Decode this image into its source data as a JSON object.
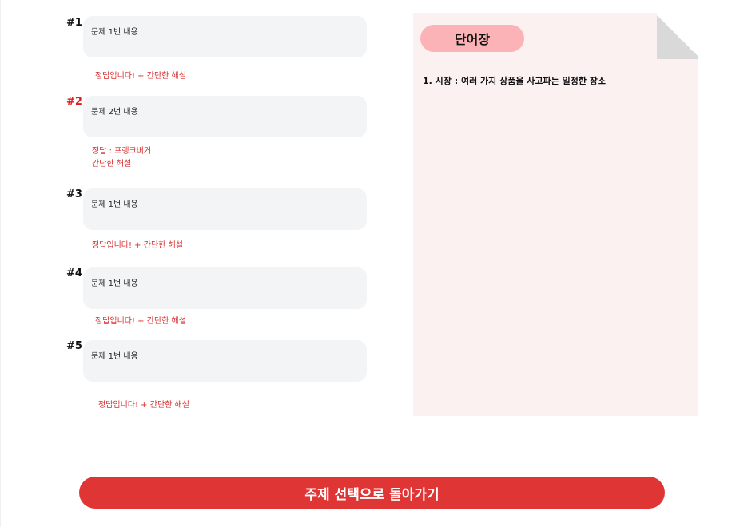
{
  "questions": [
    {
      "number": "#1",
      "content": "문제 1번 내용",
      "answer_lines": [
        "정답입니다! + 간단한 해설"
      ]
    },
    {
      "number": "#2",
      "content": "문제  2번 내용",
      "answer_lines": [
        "정답 : 프랭크버거",
        "간단한 해설"
      ]
    },
    {
      "number": "#3",
      "content": "문제 1번 내용",
      "answer_lines": [
        "정답입니다! + 간단한 해설"
      ]
    },
    {
      "number": "#4",
      "content": "문제 1번 내용",
      "answer_lines": [
        "정답입니다! + 간단한 해설"
      ]
    },
    {
      "number": "#5",
      "content": "문제 1번 내용",
      "answer_lines": [
        "정답입니다! + 간단한 해설"
      ]
    }
  ],
  "vocab": {
    "title": "단어장",
    "entries": [
      "1. 시장 : 여러 가지 상품을 사고파는 일정한 장소"
    ]
  },
  "back_button": {
    "label": "주제 선택으로 돌아가기"
  },
  "colors": {
    "accent": "#e03535",
    "answer_text": "#d92b2b",
    "question_box": "#f3f4f6",
    "vocab_bg": "#fbf1f1",
    "vocab_title_bg": "#fbb3b7"
  }
}
